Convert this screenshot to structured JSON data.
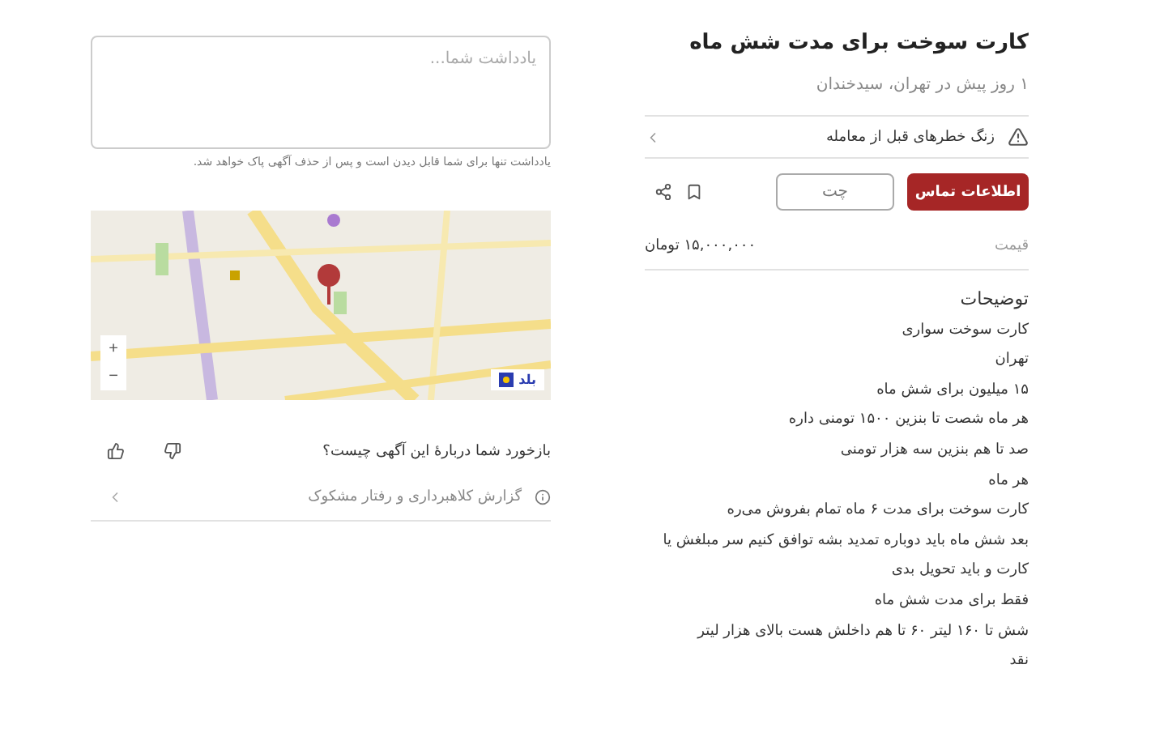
{
  "listing": {
    "title": "کارت سوخت برای مدت شش ماه",
    "subtitle": "۱ روز پیش در تهران، سیدخندان"
  },
  "warning": {
    "label": "زنگ خطرهای قبل از معامله"
  },
  "actions": {
    "contact": "اطلاعات تماس",
    "chat": "چت"
  },
  "price": {
    "label": "قیمت",
    "value": "۱۵,۰۰۰,۰۰۰ تومان"
  },
  "description": {
    "heading": "توضیحات",
    "lines": [
      "کارت سوخت سواری",
      "تهران",
      "۱۵ میلیون برای شش ماه",
      "هر ماه شصت تا بنزین ۱۵۰۰ تومنی داره",
      "صد تا هم بنزین سه هزار تومنی",
      "هر ماه",
      "کارت سوخت برای مدت ۶ ماه تمام بفروش می‌ره",
      "بعد شش ماه باید دوباره تمدید بشه توافق کنیم سر مبلغش یا",
      "کارت و باید تحویل بدی",
      "فقط برای مدت شش ماه",
      "شش تا ۱۶۰ لیتر ۶۰ تا هم داخلش هست بالای هزار لیتر",
      "نقد"
    ]
  },
  "note": {
    "placeholder": "یادداشت شما...",
    "hint": "یادداشت تنها برای شما قابل دیدن است و پس از حذف آگهی پاک خواهد شد."
  },
  "map": {
    "kind": "picture",
    "zoom_in": "+",
    "zoom_out": "−",
    "badge": "بلد"
  },
  "feedback": {
    "question": "بازخورد شما دربارهٔ این آگهی چیست؟"
  },
  "report": {
    "label": "گزارش کلاهبرداری و رفتار مشکوک"
  }
}
